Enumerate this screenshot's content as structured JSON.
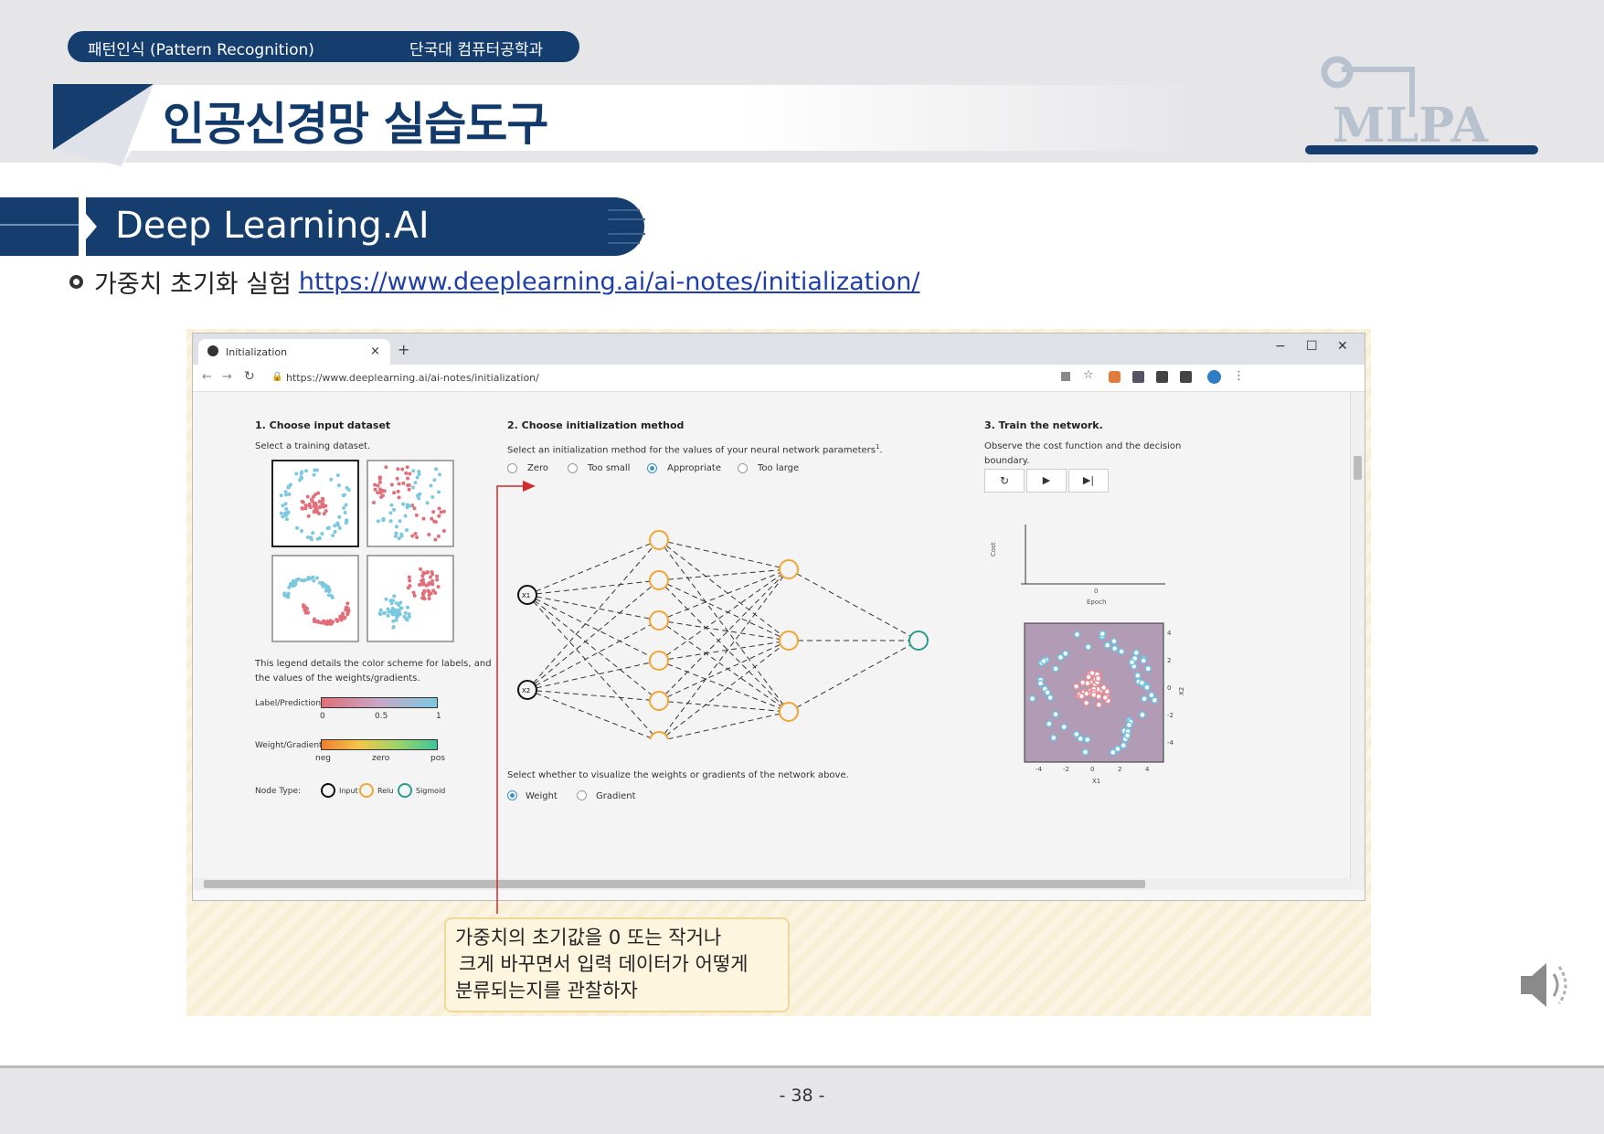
{
  "header": {
    "course": "패턴인식 (Pattern Recognition)",
    "department": "단국대 컴퓨터공학과",
    "title": "인공신경망 실습도구",
    "logo": "MLPA"
  },
  "section": {
    "title": "Deep Learning.AI",
    "bullet_text": "가중치 초기화 실험",
    "bullet_link": "https://www.deeplearning.ai/ai-notes/initialization/"
  },
  "browser": {
    "tab_title": "Initialization",
    "new_tab": "+",
    "url": "https://www.deeplearning.ai/ai-notes/initialization/",
    "win_min": "−",
    "win_max": "☐",
    "win_close": "✕"
  },
  "panel1": {
    "heading": "1. Choose input dataset",
    "subtitle": "Select a training dataset.",
    "legend_desc_1": "This legend details the color scheme for labels, and",
    "legend_desc_2": "the values of the weights/gradients.",
    "label_pred": "Label/Prediction:",
    "label_ticks": [
      "0",
      "0.5",
      "1"
    ],
    "weight_grad": "Weight/Gradient:",
    "weight_ticks": [
      "neg",
      "zero",
      "pos"
    ],
    "node_type": "Node Type:",
    "node_input": "Input",
    "node_relu": "Relu",
    "node_sigmoid": "Sigmoid"
  },
  "panel2": {
    "heading": "2. Choose initialization method",
    "subtitle": "Select an initialization method for the values of your neural network parameters",
    "footnote": "1",
    "options": [
      "Zero",
      "Too small",
      "Appropriate",
      "Too large"
    ],
    "selected_option": "Appropriate",
    "input_nodes": [
      "X1",
      "X2"
    ],
    "visualize_text": "Select whether to visualize the weights or gradients of the network above.",
    "visualize_options": [
      "Weight",
      "Gradient"
    ],
    "selected_visualize": "Weight"
  },
  "panel3": {
    "heading": "3. Train the network.",
    "subtitle_1": "Observe the cost function and the decision",
    "subtitle_2": "boundary.",
    "controls": [
      "reset-icon",
      "play-icon",
      "step-icon"
    ],
    "cost_axis_label": "Cost",
    "epoch_label": "Epoch",
    "epoch_tick": "0",
    "x_ticks": [
      "-4",
      "-2",
      "0",
      "2",
      "4"
    ],
    "y_ticks": [
      "4",
      "2",
      "0",
      "-2",
      "-4"
    ],
    "x_axis_label": "X1",
    "y_axis_label": "X2"
  },
  "callout": {
    "line1": "가중치의 초기값을 0 또는 작거나",
    "line2": "크게 바꾸면서 입력 데이터가 어떻게",
    "line3": "분류되는지를 관찰하자"
  },
  "footer": {
    "page": "- 38 -"
  },
  "colors": {
    "navy": "#153d6d",
    "blue_points": "#7cc8e0",
    "red_points": "#e06f7a",
    "relu": "#f2a533",
    "sigmoid": "#2a9d8f",
    "arrow": "#d12b2b"
  }
}
